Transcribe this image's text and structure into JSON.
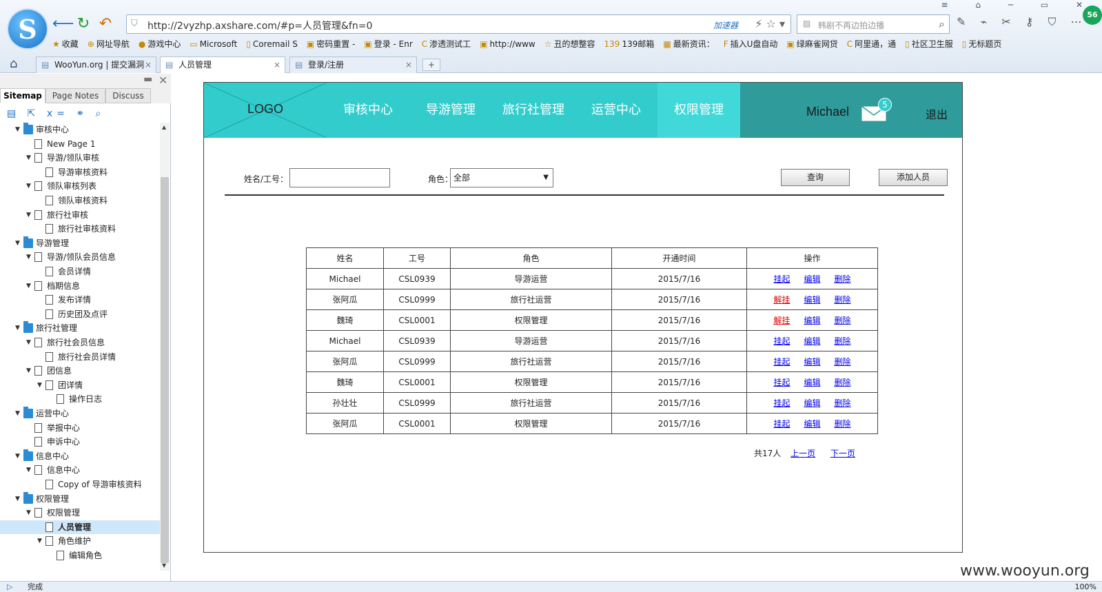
{
  "browser": {
    "logo_letter": "S",
    "address": "http://2vyzhp.axshare.com/#p=人员管理&fn=0",
    "accelerator": "加速器",
    "search_placeholder": "韩剧不再边拍边播",
    "badge": "56",
    "bookmarks": [
      {
        "icon": "★",
        "label": "收藏"
      },
      {
        "icon": "⊕",
        "label": "网址导航"
      },
      {
        "icon": "●",
        "label": "游戏中心"
      },
      {
        "icon": "▭",
        "label": "Microsoft"
      },
      {
        "icon": "▯",
        "label": "Coremail S"
      },
      {
        "icon": "▣",
        "label": "密码重置 -"
      },
      {
        "icon": "▣",
        "label": "登录 - Enr"
      },
      {
        "icon": "C",
        "label": "渗透测试工"
      },
      {
        "icon": "▣",
        "label": "http://www"
      },
      {
        "icon": "☆",
        "label": "丑的想整容"
      },
      {
        "icon": "139",
        "label": "139邮箱"
      },
      {
        "icon": "▦",
        "label": "最新资讯："
      },
      {
        "icon": "F",
        "label": "插入U盘自动"
      },
      {
        "icon": "▣",
        "label": "绿麻雀网贷"
      },
      {
        "icon": "C",
        "label": "阿里通，通"
      },
      {
        "icon": "▯",
        "label": "社区卫生服"
      },
      {
        "icon": "▯",
        "label": "无标题页"
      }
    ],
    "tabs": [
      {
        "label": "WooYun.org | 提交漏洞"
      },
      {
        "label": "人员管理"
      },
      {
        "label": "登录/注册"
      }
    ],
    "status": "完成",
    "zoom": "100%",
    "watermark": "www.wooyun.org"
  },
  "sitemap": {
    "tabs": [
      "Sitemap",
      "Page Notes",
      "Discuss"
    ],
    "tree": [
      {
        "label": "审核中心",
        "level": 0,
        "type": "folder",
        "expanded": true
      },
      {
        "label": "New Page 1",
        "level": 1,
        "type": "page",
        "expanded": null
      },
      {
        "label": "导游/领队审核",
        "level": 1,
        "type": "page",
        "expanded": true
      },
      {
        "label": "导游审核资料",
        "level": 2,
        "type": "page",
        "expanded": null
      },
      {
        "label": "领队审核列表",
        "level": 1,
        "type": "page",
        "expanded": true
      },
      {
        "label": "领队审核资料",
        "level": 2,
        "type": "page",
        "expanded": null
      },
      {
        "label": "旅行社审核",
        "level": 1,
        "type": "page",
        "expanded": true
      },
      {
        "label": "旅行社审核资料",
        "level": 2,
        "type": "page",
        "expanded": null
      },
      {
        "label": "导游管理",
        "level": 0,
        "type": "folder",
        "expanded": true
      },
      {
        "label": "导游/领队会员信息",
        "level": 1,
        "type": "page",
        "expanded": true
      },
      {
        "label": "会员详情",
        "level": 2,
        "type": "page",
        "expanded": null
      },
      {
        "label": "档期信息",
        "level": 1,
        "type": "page",
        "expanded": true
      },
      {
        "label": "发布详情",
        "level": 2,
        "type": "page",
        "expanded": null
      },
      {
        "label": "历史团及点评",
        "level": 2,
        "type": "page",
        "expanded": null
      },
      {
        "label": "旅行社管理",
        "level": 0,
        "type": "folder",
        "expanded": true
      },
      {
        "label": "旅行社会员信息",
        "level": 1,
        "type": "page",
        "expanded": true
      },
      {
        "label": "旅行社会员详情",
        "level": 2,
        "type": "page",
        "expanded": null
      },
      {
        "label": "团信息",
        "level": 1,
        "type": "page",
        "expanded": true
      },
      {
        "label": "团详情",
        "level": 2,
        "type": "page",
        "expanded": true
      },
      {
        "label": "操作日志",
        "level": 3,
        "type": "page",
        "expanded": null
      },
      {
        "label": "运营中心",
        "level": 0,
        "type": "folder",
        "expanded": true
      },
      {
        "label": "举报中心",
        "level": 1,
        "type": "page",
        "expanded": null
      },
      {
        "label": "申诉中心",
        "level": 1,
        "type": "page",
        "expanded": null
      },
      {
        "label": "信息中心",
        "level": 0,
        "type": "folder",
        "expanded": true
      },
      {
        "label": "信息中心",
        "level": 1,
        "type": "page",
        "expanded": true
      },
      {
        "label": "Copy of 导游审核资料",
        "level": 2,
        "type": "page",
        "expanded": null
      },
      {
        "label": "权限管理",
        "level": 0,
        "type": "folder",
        "expanded": true
      },
      {
        "label": "权限管理",
        "level": 1,
        "type": "page",
        "expanded": true
      },
      {
        "label": "人员管理",
        "level": 2,
        "type": "page",
        "expanded": null,
        "selected": true
      },
      {
        "label": "角色维护",
        "level": 2,
        "type": "page",
        "expanded": true
      },
      {
        "label": "编辑角色",
        "level": 3,
        "type": "page",
        "expanded": null
      }
    ]
  },
  "app": {
    "logo": "LOGO",
    "nav": [
      "审核中心",
      "导游管理",
      "旅行社管理",
      "运营中心",
      "权限管理"
    ],
    "active_nav": 4,
    "user_name": "Michael",
    "mail_count": "5",
    "logout": "退出",
    "filter": {
      "name_label": "姓名/工号：",
      "name_value": "",
      "role_label": "角色：",
      "role_value": "全部",
      "query_button": "查询",
      "add_button": "添加人员"
    },
    "table": {
      "headers": [
        "姓名",
        "工号",
        "角色",
        "开通时间",
        "操作"
      ],
      "rows": [
        {
          "name": "Michael",
          "id": "CSL0939",
          "role": "导游运营",
          "date": "2015/7/16",
          "toggle": "挂起",
          "toggle_red": false
        },
        {
          "name": "张阿瓜",
          "id": "CSL0999",
          "role": "旅行社运营",
          "date": "2015/7/16",
          "toggle": "解挂",
          "toggle_red": true
        },
        {
          "name": "魏琦",
          "id": "CSL0001",
          "role": "权限管理",
          "date": "2015/7/16",
          "toggle": "解挂",
          "toggle_red": true
        },
        {
          "name": "Michael",
          "id": "CSL0939",
          "role": "导游运营",
          "date": "2015/7/16",
          "toggle": "挂起",
          "toggle_red": false
        },
        {
          "name": "张阿瓜",
          "id": "CSL0999",
          "role": "旅行社运营",
          "date": "2015/7/16",
          "toggle": "挂起",
          "toggle_red": false
        },
        {
          "name": "魏琦",
          "id": "CSL0001",
          "role": "权限管理",
          "date": "2015/7/16",
          "toggle": "挂起",
          "toggle_red": false
        },
        {
          "name": "孙壮壮",
          "id": "CSL0999",
          "role": "旅行社运营",
          "date": "2015/7/16",
          "toggle": "挂起",
          "toggle_red": false
        },
        {
          "name": "张阿瓜",
          "id": "CSL0001",
          "role": "权限管理",
          "date": "2015/7/16",
          "toggle": "挂起",
          "toggle_red": false
        }
      ],
      "edit_label": "编辑",
      "delete_label": "删除"
    },
    "pager": {
      "total": "共17人",
      "prev": "上一页",
      "next": "下一页"
    }
  }
}
